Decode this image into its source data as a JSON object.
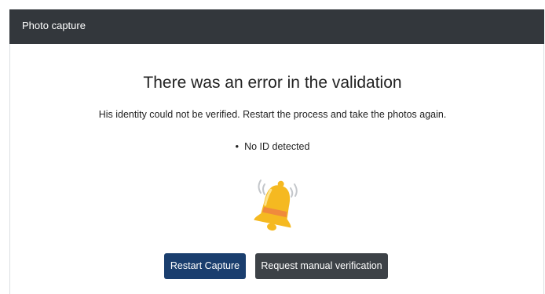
{
  "header": {
    "title": "Photo capture"
  },
  "main": {
    "title": "There was an error in the validation",
    "message": "His identity could not be verified. Restart the process and take the photos again.",
    "errors": [
      "No ID detected"
    ],
    "illustration_icon": "bell-icon"
  },
  "actions": {
    "restart_label": "Restart Capture",
    "manual_label": "Request manual verification"
  },
  "colors": {
    "header_bg": "#33373c",
    "primary_button": "#1a3e6e",
    "secondary_button": "#3d4247",
    "bell_yellow": "#f5b921",
    "bell_band": "#f08a3c"
  }
}
